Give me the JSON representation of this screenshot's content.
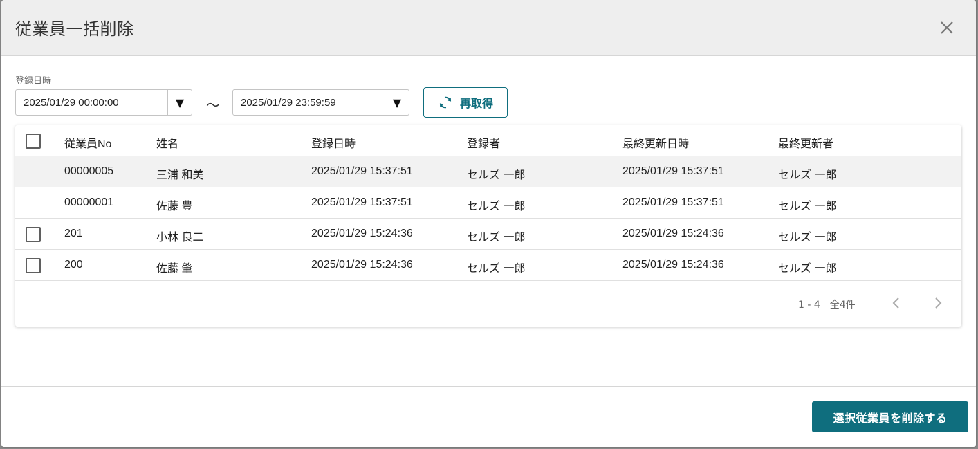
{
  "dialog": {
    "title": "従業員一括削除"
  },
  "filter": {
    "label": "登録日時",
    "from_value": "2025/01/29 00:00:00",
    "to_value": "2025/01/29 23:59:59",
    "separator": "～",
    "dropdown_glyph": "▼",
    "refresh_label": "再取得"
  },
  "table": {
    "headers": [
      "従業員No",
      "姓名",
      "登録日時",
      "登録者",
      "最終更新日時",
      "最終更新者"
    ],
    "rows": [
      {
        "no": "00000005",
        "name": "三浦 和美",
        "registered_at": "2025/01/29 15:37:51",
        "registered_by": "セルズ 一郎",
        "updated_at": "2025/01/29 15:37:51",
        "updated_by": "セルズ 一郎",
        "has_checkbox": false,
        "highlighted": true
      },
      {
        "no": "00000001",
        "name": "佐藤 豊",
        "registered_at": "2025/01/29 15:37:51",
        "registered_by": "セルズ 一郎",
        "updated_at": "2025/01/29 15:37:51",
        "updated_by": "セルズ 一郎",
        "has_checkbox": false,
        "highlighted": false
      },
      {
        "no": "201",
        "name": "小林 良二",
        "registered_at": "2025/01/29 15:24:36",
        "registered_by": "セルズ 一郎",
        "updated_at": "2025/01/29 15:24:36",
        "updated_by": "セルズ 一郎",
        "has_checkbox": true,
        "highlighted": false
      },
      {
        "no": "200",
        "name": "佐藤 肇",
        "registered_at": "2025/01/29 15:24:36",
        "registered_by": "セルズ 一郎",
        "updated_at": "2025/01/29 15:24:36",
        "updated_by": "セルズ 一郎",
        "has_checkbox": true,
        "highlighted": false
      }
    ]
  },
  "pagination": {
    "info": "1 - 4　全4件"
  },
  "footer": {
    "delete_label": "選択従業員を削除する"
  },
  "colors": {
    "accent": "#0f6e7e",
    "header_bg": "#eeeeee",
    "selected_row_bg": "#f2f2f2"
  },
  "icons": {
    "close": "close-icon",
    "refresh": "refresh-icon",
    "prev": "chevron-left-icon",
    "next": "chevron-right-icon"
  }
}
